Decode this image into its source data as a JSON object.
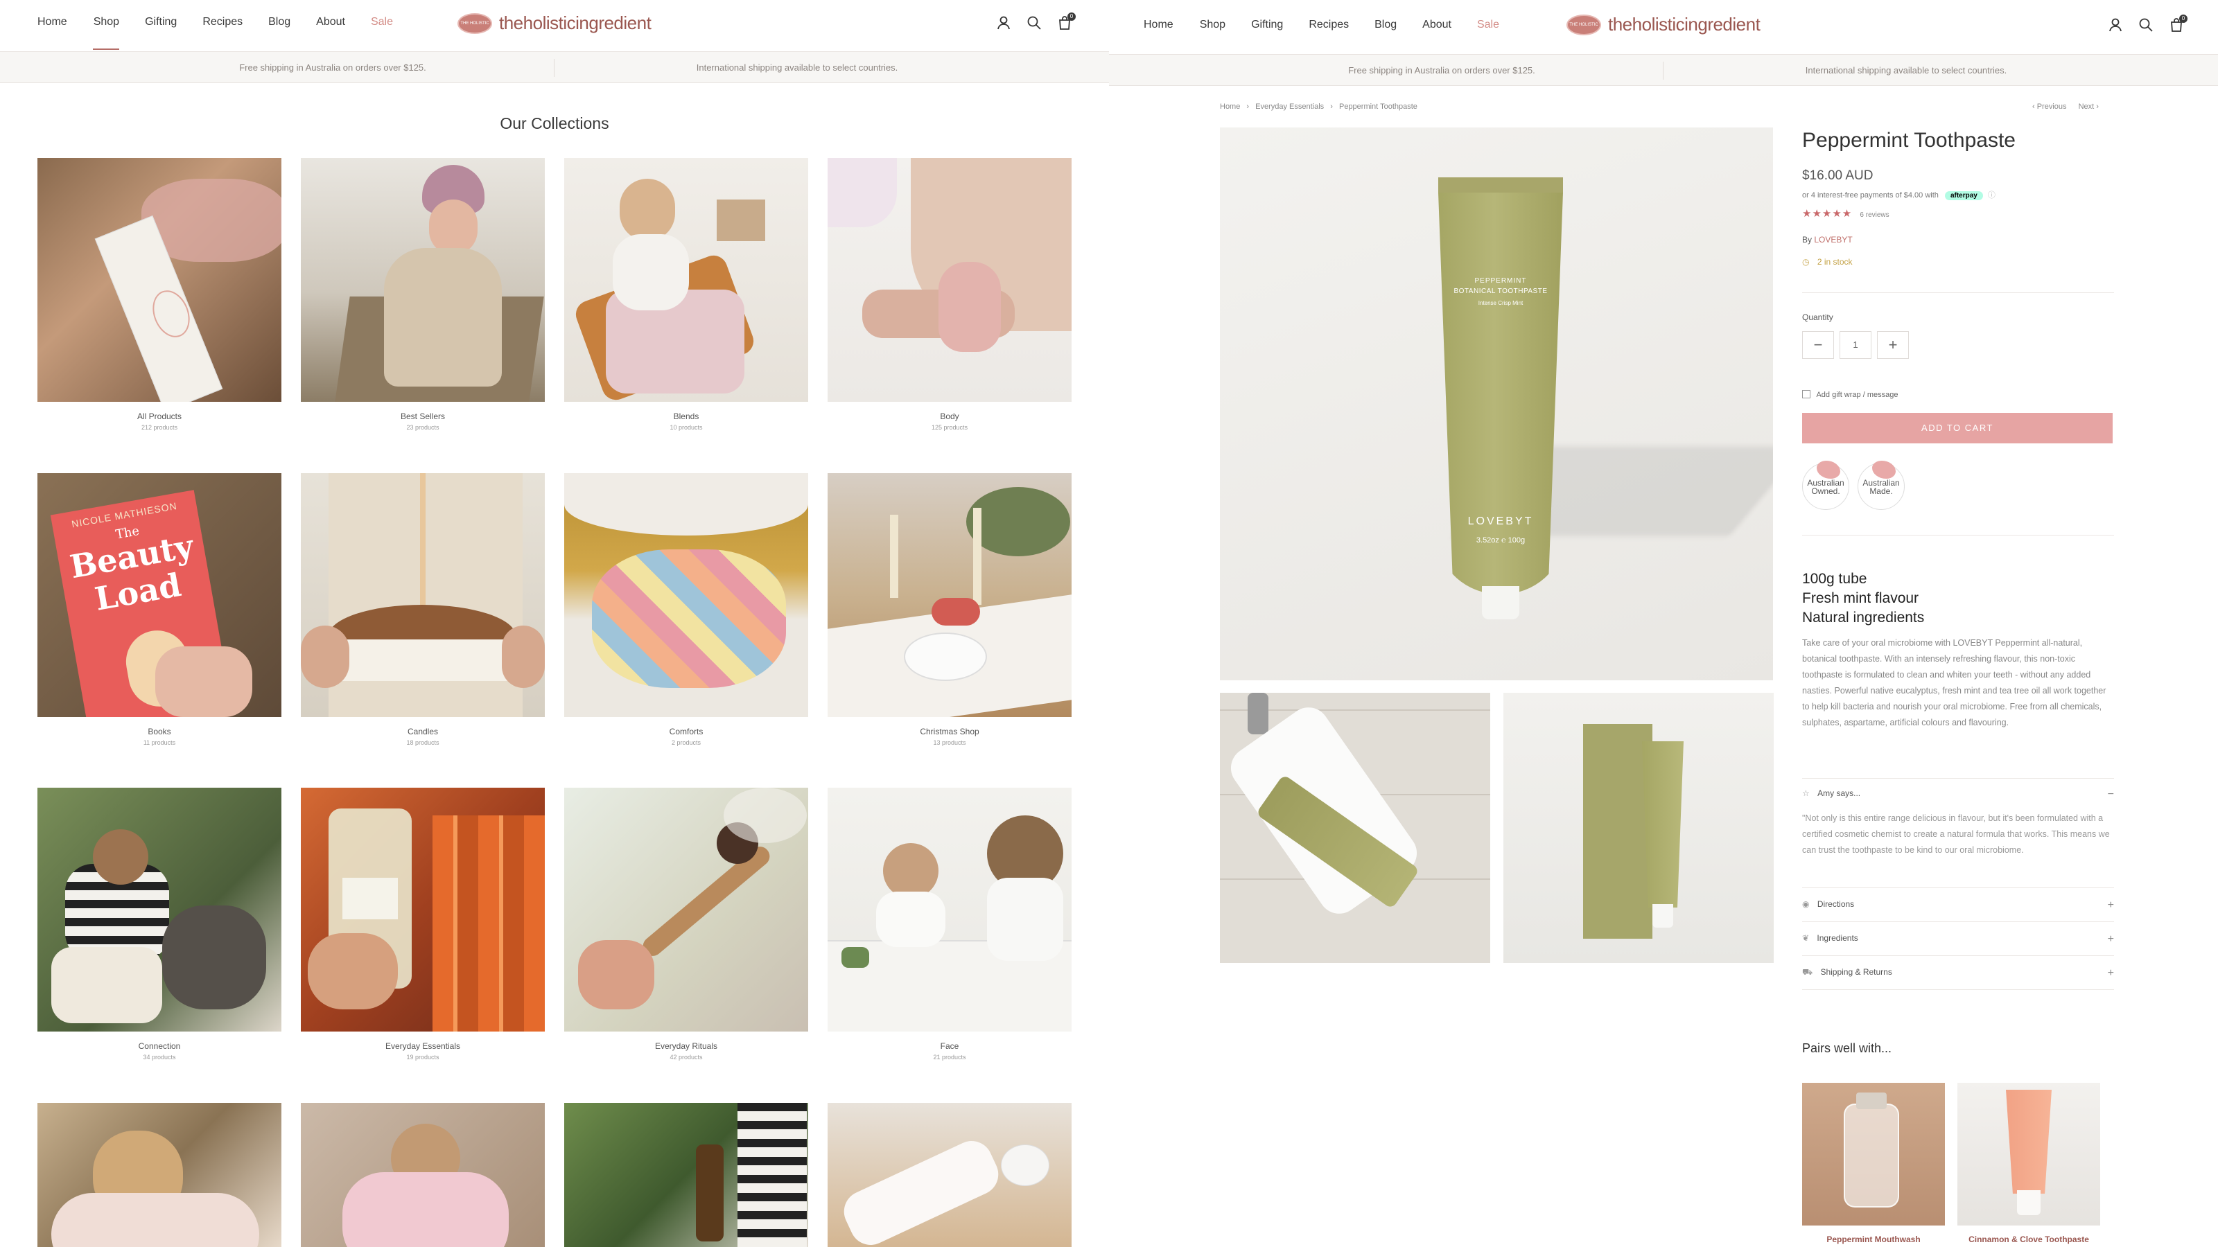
{
  "nav": {
    "home": "Home",
    "shop": "Shop",
    "gifting": "Gifting",
    "recipes": "Recipes",
    "blog": "Blog",
    "about": "About",
    "sale": "Sale"
  },
  "logo": {
    "wordmark": "theholisticingredient",
    "badge": "THE HOLISTIC"
  },
  "cart_count": "0",
  "announcement": {
    "left": "Free shipping in Australia on orders over $125.",
    "right": "International shipping available to select countries."
  },
  "collections_title": "Our Collections",
  "collections": [
    {
      "name": "All Products",
      "count": "212 products"
    },
    {
      "name": "Best Sellers",
      "count": "23 products"
    },
    {
      "name": "Blends",
      "count": "10 products"
    },
    {
      "name": "Body",
      "count": "125 products"
    },
    {
      "name": "Books",
      "count": "11 products"
    },
    {
      "name": "Candles",
      "count": "18 products"
    },
    {
      "name": "Comforts",
      "count": "2 products"
    },
    {
      "name": "Christmas Shop",
      "count": "13 products"
    },
    {
      "name": "Connection",
      "count": "34 products"
    },
    {
      "name": "Everyday Essentials",
      "count": "19 products"
    },
    {
      "name": "Everyday Rituals",
      "count": "42 products"
    },
    {
      "name": "Face",
      "count": "21 products"
    },
    {
      "name": "",
      "count": ""
    },
    {
      "name": "",
      "count": ""
    },
    {
      "name": "",
      "count": ""
    },
    {
      "name": "",
      "count": ""
    }
  ],
  "breadcrumb": {
    "home": "Home",
    "collection": "Everyday Essentials",
    "current": "Peppermint Toothpaste"
  },
  "pager": {
    "prev": "‹ Previous",
    "next": "Next ›"
  },
  "product": {
    "title": "Peppermint Toothpaste",
    "price": "$16.00 AUD",
    "afterpay_text": "or 4 interest-free payments of $4.00 with",
    "afterpay_label": "afterpay",
    "stars": "★★★★★",
    "reviews": "6 reviews",
    "by_label": "By",
    "brand": "LOVEBYT",
    "stock": "2 in stock",
    "quantity_label": "Quantity",
    "quantity": "1",
    "gift_wrap": "Add gift wrap / message",
    "add_to_cart": "ADD TO CART",
    "seal_owned": "Australian Owned.",
    "seal_made": "Australian Made.",
    "features": [
      "100g tube",
      "Fresh mint flavour",
      "Natural ingredients"
    ],
    "description": "Take care of your oral microbiome with LOVEBYT Peppermint all-natural, botanical toothpaste. With an intensely refreshing flavour, this non-toxic toothpaste is formulated to clean and whiten your teeth - without any added nasties. Powerful native eucalyptus, fresh mint and tea tree oil all work together to help kill bacteria and nourish your oral microbiome. Free from all chemicals, sulphates, aspartame, artificial colours and flavouring.",
    "amy_title": "Amy says...",
    "amy_quote": "\"Not only is this entire range delicious in flavour, but it's been formulated with a certified cosmetic chemist to create a natural formula that works. This means we can trust the toothpaste to be kind to our oral microbiome.",
    "acc_directions": "Directions",
    "acc_ingredients": "Ingredients",
    "acc_shipping": "Shipping & Returns",
    "tube_text1": "PEPPERMINT",
    "tube_text2": "BOTANICAL TOOTHPASTE",
    "tube_text3": "Intense Crisp Mint",
    "tube_brand": "LOVEBYT",
    "tube_weight": "3.52oz ℮ 100g"
  },
  "pairs_title": "Pairs well with...",
  "pairs": [
    {
      "name": "Peppermint Mouthwash"
    },
    {
      "name": "Cinnamon & Clove Toothpaste"
    }
  ],
  "book": {
    "author": "NICOLE MATHIESON",
    "title1": "The",
    "title2": "Beauty",
    "title3": "Load"
  }
}
